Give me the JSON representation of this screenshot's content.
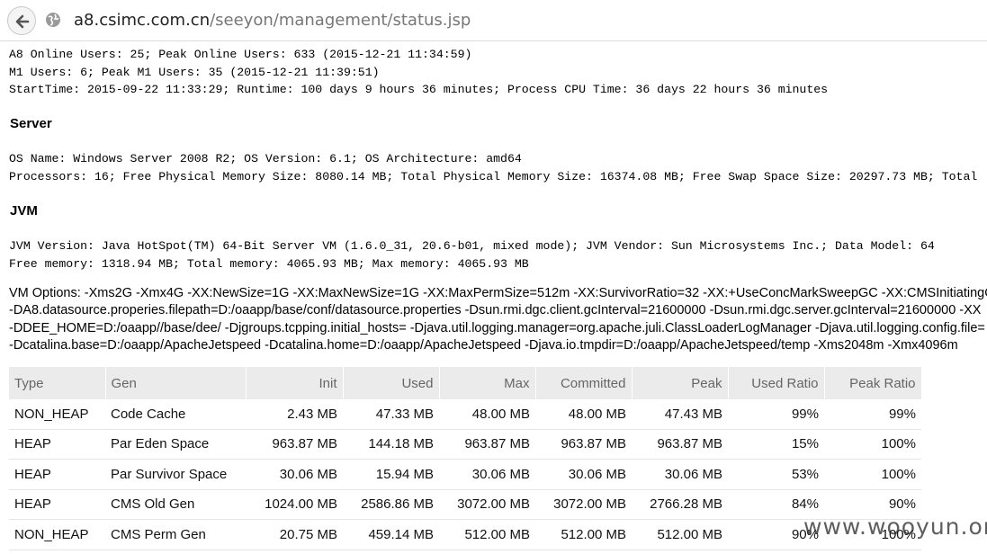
{
  "browser": {
    "url_host": "a8.csimc.com.cn",
    "url_path": "/seeyon/management/status.jsp"
  },
  "status_lines": [
    "A8 Online Users: 25; Peak Online Users: 633 (2015-12-21 11:34:59)",
    "M1 Users: 6; Peak M1 Users: 35 (2015-12-21 11:39:51)",
    "StartTime: 2015-09-22 11:33:29; Runtime: 100 days 9 hours 36 minutes; Process CPU Time: 36 days 22 hours 36 minutes"
  ],
  "server": {
    "heading": "Server",
    "lines": [
      "OS Name: Windows Server 2008 R2; OS Version: 6.1; OS Architecture: amd64",
      "Processors: 16; Free Physical Memory Size: 8080.14 MB; Total Physical Memory Size: 16374.08 MB; Free Swap Space Size: 20297.73 MB; Total"
    ]
  },
  "jvm": {
    "heading": "JVM",
    "lines": [
      "JVM Version: Java HotSpot(TM) 64-Bit Server VM (1.6.0_31, 20.6-b01, mixed mode); JVM Vendor: Sun Microsystems Inc.; Data Model: 64",
      "Free memory: 1318.94 MB; Total memory: 4065.93 MB; Max memory: 4065.93 MB"
    ],
    "vm_options": [
      "VM Options: -Xms2G -Xmx4G -XX:NewSize=1G -XX:MaxNewSize=1G -XX:MaxPermSize=512m -XX:SurvivorRatio=32 -XX:+UseConcMarkSweepGC -XX:CMSInitiatingO",
      "-DA8.datasource.properies.filepath=D:/oaapp/base/conf/datasource.properties -Dsun.rmi.dgc.client.gcInterval=21600000 -Dsun.rmi.dgc.server.gcInterval=21600000 -XX",
      "-DDEE_HOME=D:/oaapp//base/dee/ -Djgroups.tcpping.initial_hosts= -Djava.util.logging.manager=org.apache.juli.ClassLoaderLogManager -Djava.util.logging.config.file=",
      "-Dcatalina.base=D:/oaapp/ApacheJetspeed -Dcatalina.home=D:/oaapp/ApacheJetspeed -Djava.io.tmpdir=D:/oaapp/ApacheJetspeed/temp -Xms2048m -Xmx4096m"
    ]
  },
  "memory_table": {
    "headers": [
      "Type",
      "Gen",
      "Init",
      "Used",
      "Max",
      "Committed",
      "Peak",
      "Used Ratio",
      "Peak Ratio"
    ],
    "rows": [
      [
        "NON_HEAP",
        "Code Cache",
        "2.43 MB",
        "47.33 MB",
        "48.00 MB",
        "48.00 MB",
        "47.43 MB",
        "99%",
        "99%"
      ],
      [
        "HEAP",
        "Par Eden Space",
        "963.87 MB",
        "144.18 MB",
        "963.87 MB",
        "963.87 MB",
        "963.87 MB",
        "15%",
        "100%"
      ],
      [
        "HEAP",
        "Par Survivor Space",
        "30.06 MB",
        "15.94 MB",
        "30.06 MB",
        "30.06 MB",
        "30.06 MB",
        "53%",
        "100%"
      ],
      [
        "HEAP",
        "CMS Old Gen",
        "1024.00 MB",
        "2586.86 MB",
        "3072.00 MB",
        "3072.00 MB",
        "2766.28 MB",
        "84%",
        "90%"
      ],
      [
        "NON_HEAP",
        "CMS Perm Gen",
        "20.75 MB",
        "459.14 MB",
        "512.00 MB",
        "512.00 MB",
        "512.00 MB",
        "90%",
        "100%"
      ]
    ]
  },
  "watermark": "www.wooyun.org"
}
